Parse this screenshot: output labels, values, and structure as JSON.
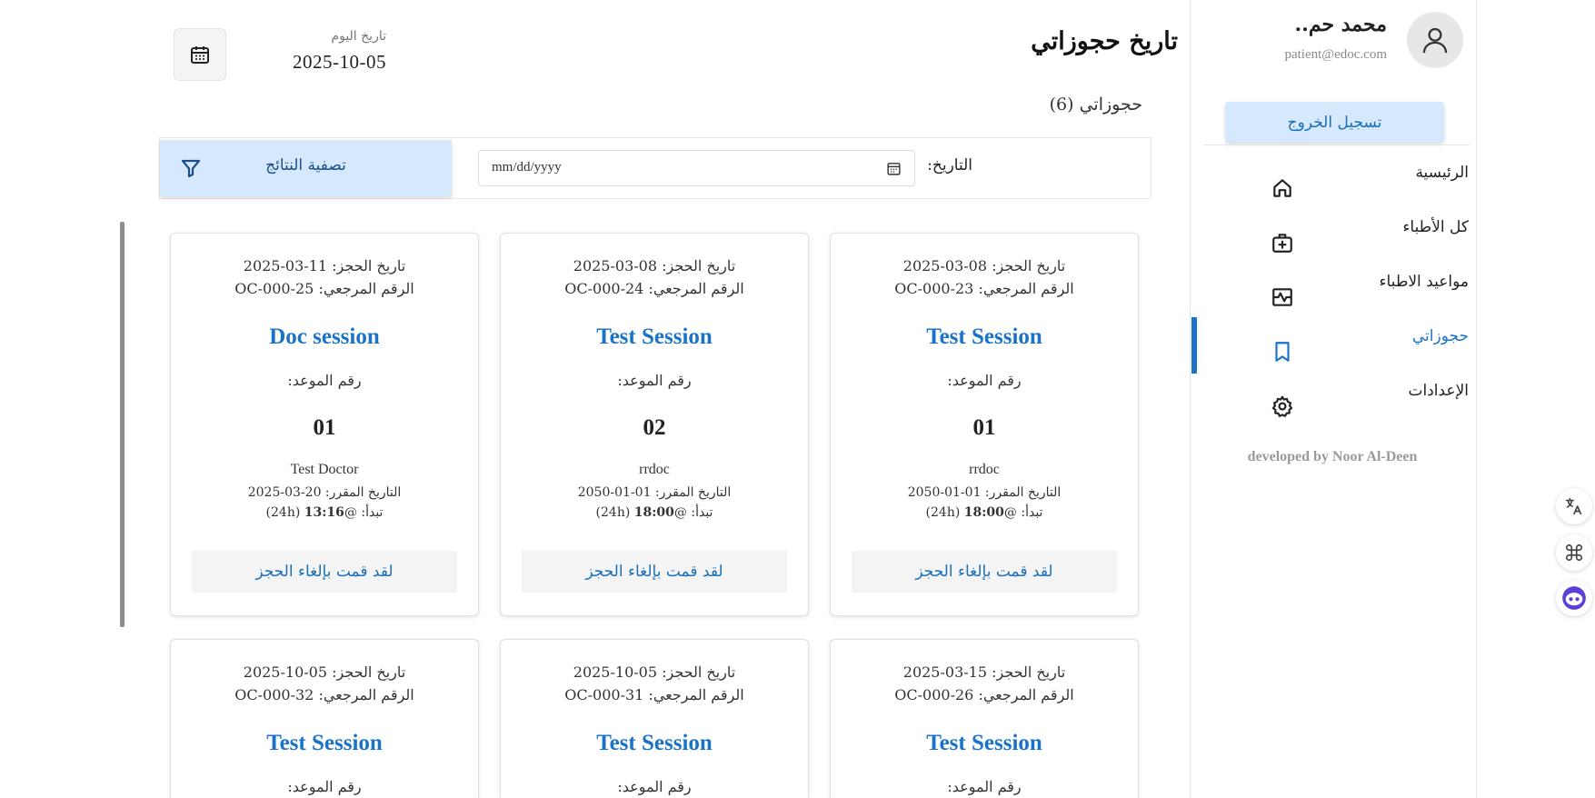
{
  "user": {
    "name": "محمد حم..",
    "email": "patient@edoc.com"
  },
  "sidebar": {
    "logout_label": "تسجيل الخروج",
    "items": [
      {
        "label": "الرئيسية",
        "icon": "home-icon"
      },
      {
        "label": "كل الأطباء",
        "icon": "medical-bag-icon"
      },
      {
        "label": "مواعيد الاطباء",
        "icon": "schedule-icon"
      },
      {
        "label": "حجوزاتي",
        "icon": "bookmark-icon",
        "active": true
      },
      {
        "label": "الإعدادات",
        "icon": "gear-icon"
      }
    ],
    "credit": "developed by Noor Al-Deen"
  },
  "header": {
    "title": "تاريخ حجوزاتي",
    "today_label": "تاريخ اليوم",
    "today_value": "2025-10-05"
  },
  "bookings_count": "حجوزاتي (6)",
  "filter": {
    "date_label": "التاريخ:",
    "date_placeholder": "mm/dd/yyyy",
    "button_label": "تصفية النتائج"
  },
  "cards": [
    {
      "booking_date": "تاريخ الحجز: 08-03-2025",
      "reference": "الرقم المرجعي: OC-000-23",
      "title": "Test Session",
      "apno_label": "رقم الموعد:",
      "apno": "01",
      "doctor": "rrdoc",
      "scheduled": "التاريخ المقرر: 01-01-2050",
      "starts_prefix": "تبدأ: @",
      "starts_time": "18:00",
      "starts_suffix": " (24h)",
      "cancel_label": "لقد قمت بإلغاء الحجز"
    },
    {
      "booking_date": "تاريخ الحجز: 08-03-2025",
      "reference": "الرقم المرجعي: OC-000-24",
      "title": "Test Session",
      "apno_label": "رقم الموعد:",
      "apno": "02",
      "doctor": "rrdoc",
      "scheduled": "التاريخ المقرر: 01-01-2050",
      "starts_prefix": "تبدأ: @",
      "starts_time": "18:00",
      "starts_suffix": " (24h)",
      "cancel_label": "لقد قمت بإلغاء الحجز"
    },
    {
      "booking_date": "تاريخ الحجز: 11-03-2025",
      "reference": "الرقم المرجعي: OC-000-25",
      "title": "Doc session",
      "apno_label": "رقم الموعد:",
      "apno": "01",
      "doctor": "Test Doctor",
      "scheduled": "التاريخ المقرر: 20-03-2025",
      "starts_prefix": "تبدأ: @",
      "starts_time": "13:16",
      "starts_suffix": " (24h)",
      "cancel_label": "لقد قمت بإلغاء الحجز"
    },
    {
      "booking_date": "تاريخ الحجز: 15-03-2025",
      "reference": "الرقم المرجعي: OC-000-26",
      "title": "Test Session",
      "apno_label": "رقم الموعد:"
    },
    {
      "booking_date": "تاريخ الحجز: 05-10-2025",
      "reference": "الرقم المرجعي: OC-000-31",
      "title": "Test Session",
      "apno_label": "رقم الموعد:"
    },
    {
      "booking_date": "تاريخ الحجز: 05-10-2025",
      "reference": "الرقم المرجعي: OC-000-32",
      "title": "Test Session",
      "apno_label": "رقم الموعد:"
    }
  ],
  "widgets": [
    {
      "icon": "translate-icon"
    },
    {
      "icon": "command-icon"
    },
    {
      "icon": "assistant-icon"
    }
  ],
  "colors": {
    "accent": "#1a73c7",
    "button_bg": "#d6e8fb",
    "cancel_bg": "#f4f4f4"
  }
}
